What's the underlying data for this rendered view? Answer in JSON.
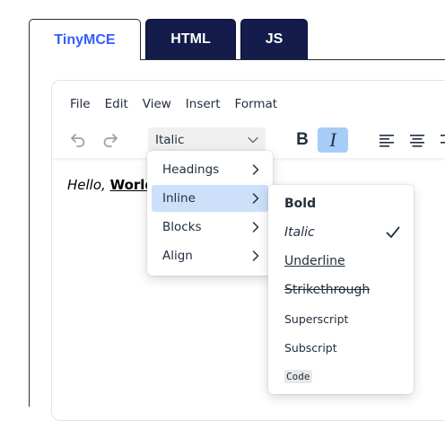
{
  "tabs": [
    {
      "label": "TinyMCE",
      "active": true
    },
    {
      "label": "HTML",
      "active": false
    },
    {
      "label": "JS",
      "active": false
    }
  ],
  "menubar": [
    "File",
    "Edit",
    "View",
    "Insert",
    "Format"
  ],
  "toolbar": {
    "undo_icon": "undo-icon",
    "redo_icon": "redo-icon",
    "format_select_value": "Italic",
    "bold_label": "B",
    "italic_label": "I",
    "italic_active": true,
    "align_icons": [
      "align-left-icon",
      "align-center-icon",
      "align-right-icon"
    ]
  },
  "content": {
    "hello": "Hello, ",
    "world": "World"
  },
  "format_menu": {
    "items": [
      {
        "label": "Headings",
        "has_submenu": true
      },
      {
        "label": "Inline",
        "has_submenu": true,
        "active": true
      },
      {
        "label": "Blocks",
        "has_submenu": true
      },
      {
        "label": "Align",
        "has_submenu": true
      }
    ]
  },
  "inline_submenu": {
    "items": [
      {
        "label": "Bold",
        "checked": false
      },
      {
        "label": "Italic",
        "checked": true
      },
      {
        "label": "Underline",
        "checked": false
      },
      {
        "label": "Strikethrough",
        "checked": false
      },
      {
        "label": "Superscript",
        "checked": false
      },
      {
        "label": "Subscript",
        "checked": false
      },
      {
        "label": "Code",
        "checked": false
      }
    ]
  },
  "colors": {
    "active_tab_text": "#335dff",
    "dark_tab_bg": "#131c4b",
    "italic_active_bg": "#a6ccf7",
    "menu_active_bg": "#cce0fa",
    "text": "#222f3e"
  }
}
